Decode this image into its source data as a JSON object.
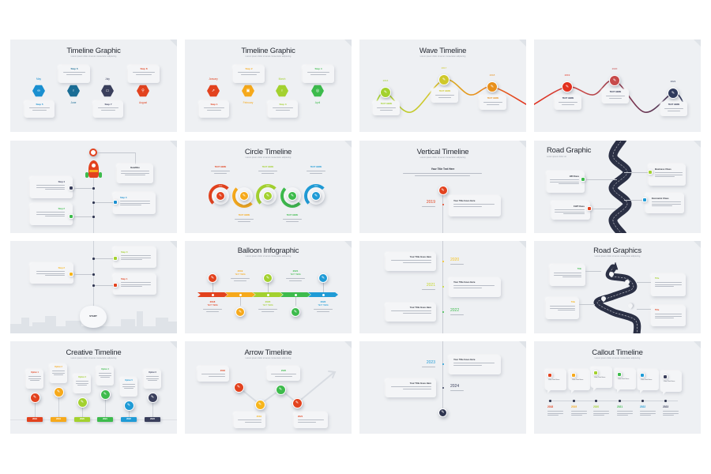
{
  "sheet": {
    "background": "#ffffff",
    "slide_background": "#eef0f3",
    "slides": [
      {
        "title": "Timeline Graphic",
        "subtitle": "Lorem ipsum dolor sit amet consectetur adipiscing",
        "items": [
          {
            "step": "Step 5",
            "month": "May",
            "color": "#1a8fd0",
            "icon": "binoculars-icon"
          },
          {
            "step": "Step 6",
            "month": "June",
            "color": "#1a6d95",
            "icon": "lightbulb-icon"
          },
          {
            "step": "Step 7",
            "month": "July",
            "color": "#3a3f5c",
            "icon": "monitor-icon"
          },
          {
            "step": "Step 8",
            "month": "August",
            "color": "#e2421e",
            "icon": "search-icon"
          }
        ]
      },
      {
        "title": "Timeline Graphic",
        "subtitle": "Lorem ipsum dolor sit amet consectetur adipiscing",
        "items": [
          {
            "step": "Step 1",
            "month": "January",
            "color": "#e2421e",
            "icon": "rocket-icon"
          },
          {
            "step": "Step 2",
            "month": "February",
            "color": "#f6a91b",
            "icon": "briefcase-icon"
          },
          {
            "step": "Step 3",
            "month": "March",
            "color": "#a3d12f",
            "icon": "lightbulb-icon"
          },
          {
            "step": "Step 4",
            "month": "April",
            "color": "#3dbb4c",
            "icon": "target-icon"
          }
        ]
      },
      {
        "title": "Wave Timeline",
        "subtitle": "Lorem ipsum dolor sit amet consectetur adipiscing",
        "items": [
          {
            "year": "2016",
            "label": "TEXT HERE",
            "color": "#a3d12f"
          },
          {
            "year": "2017",
            "label": "TEXT HERE",
            "color": "#cfc82a"
          },
          {
            "year": "2018",
            "label": "TEXT HERE",
            "color": "#e8901c"
          }
        ]
      },
      {
        "items": [
          {
            "year": "2019",
            "label": "TEXT HERE",
            "color": "#e2301e"
          },
          {
            "year": "2020",
            "label": "TEXT HERE",
            "color": "#c74a4a"
          },
          {
            "year": "2021",
            "label": "TEXT HERE",
            "color": "#2f3a5c"
          }
        ]
      },
      {
        "headline": "Headline",
        "items": [
          {
            "step": "Step 4",
            "color": "#3a3f5c"
          },
          {
            "step": "Step 3",
            "color": "#1a8fd0"
          },
          {
            "step": "Step 2",
            "color": "#3dbb4c"
          }
        ]
      },
      {
        "title": "Circle Timeline",
        "subtitle": "Lorem ipsum dolor sit amet consectetur adipiscing",
        "items": [
          {
            "label": "TEXT HERE",
            "year": "2016",
            "color": "#e2421e"
          },
          {
            "label": "TEXT HERE",
            "year": "2017",
            "color": "#f6a91b"
          },
          {
            "label": "TEXT HERE",
            "year": "2018",
            "color": "#a3d12f"
          },
          {
            "label": "TEXT HERE",
            "year": "2019",
            "color": "#3dbb4c"
          },
          {
            "label": "TEXT HERE",
            "year": "2020",
            "color": "#1f9bd6"
          }
        ]
      },
      {
        "title": "Vertical Timeline",
        "subtitle": "Lorem ipsum dolor sit amet consectetur adipiscing",
        "heading": "Your Title Text Here",
        "items": [
          {
            "year": "2019",
            "title": "Your Title Goes Here",
            "color": "#e2421e"
          }
        ]
      },
      {
        "title": "Road Graphic",
        "subtitle": "Lorem ipsum dolor sit",
        "items": [
          {
            "label": "HR Class",
            "color": "#3dbb4c"
          },
          {
            "label": "CHP Class",
            "color": "#e2421e"
          },
          {
            "label": "Business Class",
            "color": "#a3d12f"
          },
          {
            "label": "Economic Class",
            "color": "#1f9bd6"
          }
        ]
      },
      {
        "start": "START",
        "items": [
          {
            "step": "Step 3",
            "color": "#a3d12f"
          },
          {
            "step": "Step 2",
            "color": "#f6b51b"
          },
          {
            "step": "Step 1",
            "color": "#e2421e"
          }
        ]
      },
      {
        "title": "Balloon Infographic",
        "subtitle": "Lorem ipsum dolor sit amet consectetur adipiscing",
        "items": [
          {
            "year": "2018",
            "label": "TEXT HERE",
            "color": "#e2421e"
          },
          {
            "year": "2019",
            "label": "TEXT HERE",
            "color": "#f6a91b"
          },
          {
            "year": "2020",
            "label": "TEXT HERE",
            "color": "#a3d12f"
          },
          {
            "year": "2021",
            "label": "TEXT HERE",
            "color": "#3dbb4c"
          },
          {
            "year": "2022",
            "label": "TEXT HERE",
            "color": "#1f9bd6"
          }
        ]
      },
      {
        "items": [
          {
            "year": "2020",
            "title": "Your Title Goes Here",
            "color": "#f6c21b"
          },
          {
            "year": "2021",
            "title": "Your Title Goes Here",
            "color": "#c5d82a"
          },
          {
            "year": "2022",
            "title": "Your Title Goes Here",
            "color": "#3dbb4c"
          }
        ]
      },
      {
        "title": "Road Graphics",
        "subtitle": "Lorem ipsum dolor sit amet consectetur adipiscing",
        "items": [
          {
            "label": "Title",
            "color": "#3dbb4c"
          },
          {
            "label": "Title",
            "color": "#a3d12f"
          },
          {
            "label": "Title",
            "color": "#f6b51b"
          },
          {
            "label": "Title",
            "color": "#e2421e"
          }
        ]
      },
      {
        "title": "Creative Timeline",
        "subtitle": "Lorem ipsum dolor sit amet consectetur adipiscing",
        "items": [
          {
            "label": "Option 1",
            "year": "2018",
            "color": "#e2421e"
          },
          {
            "label": "Option 2",
            "year": "2019",
            "color": "#f6a91b"
          },
          {
            "label": "Option 3",
            "year": "2020",
            "color": "#a3d12f"
          },
          {
            "label": "Option 4",
            "year": "2021",
            "color": "#3dbb4c"
          },
          {
            "label": "Option 5",
            "year": "2022",
            "color": "#1f9bd6"
          },
          {
            "label": "Option 6",
            "year": "2023",
            "color": "#3a3f5c"
          }
        ]
      },
      {
        "title": "Arrow Timeline",
        "subtitle": "Lorem ipsum dolor sit amet consectetur adipiscing",
        "items": [
          {
            "year": "2018",
            "color": "#e2421e"
          },
          {
            "year": "2019",
            "color": "#f6b51b"
          },
          {
            "year": "2020",
            "color": "#3dbb4c"
          },
          {
            "year": "2021",
            "color": "#e2421e"
          }
        ]
      },
      {
        "items": [
          {
            "year": "2023",
            "title": "Your Title Goes Here",
            "color": "#1f9bd6"
          },
          {
            "year": "2024",
            "title": "Your Title Goes Here",
            "color": "#3a3f5c"
          }
        ]
      },
      {
        "title": "Callout Timeline",
        "subtitle": "Lorem ipsum dolor sit amet consectetur adipiscing",
        "items": [
          {
            "label": "Your Text Here",
            "year": "2018",
            "color": "#e2421e"
          },
          {
            "label": "Your Text Here",
            "year": "2019",
            "color": "#f6a91b"
          },
          {
            "label": "Your Text Here",
            "year": "2020",
            "color": "#a3d12f"
          },
          {
            "label": "Your Text Here",
            "year": "2021",
            "color": "#3dbb4c"
          },
          {
            "label": "Your Text Here",
            "year": "2022",
            "color": "#1f9bd6"
          },
          {
            "label": "Your Text Here",
            "year": "2023",
            "color": "#3a3f5c"
          }
        ]
      }
    ]
  }
}
